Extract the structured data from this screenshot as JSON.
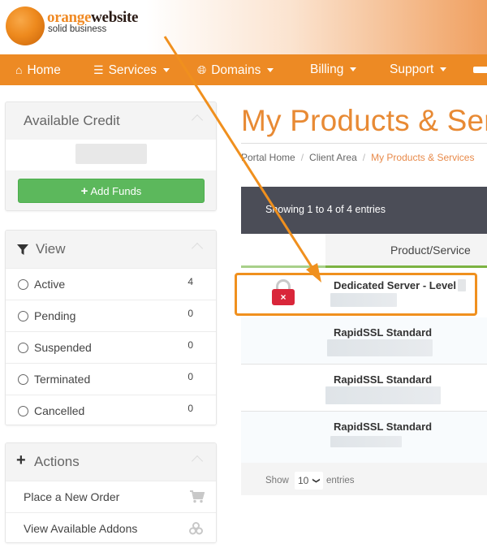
{
  "brand": {
    "name_part1": "orange",
    "name_part2": "website",
    "tagline": "solid business",
    "accent_color": "#ed8a24"
  },
  "nav": {
    "items": [
      {
        "label": "Home",
        "icon": "home-icon"
      },
      {
        "label": "Services",
        "icon": "bars-icon",
        "dropdown": true
      },
      {
        "label": "Domains",
        "icon": "globe-icon",
        "dropdown": true
      },
      {
        "label": "Billing",
        "dropdown": true
      },
      {
        "label": "Support",
        "dropdown": true
      }
    ]
  },
  "sidebar": {
    "credit": {
      "title": "Available Credit",
      "add_funds_label": "Add Funds"
    },
    "view": {
      "title": "View",
      "items": [
        {
          "label": "Active",
          "count": "4"
        },
        {
          "label": "Pending",
          "count": "0"
        },
        {
          "label": "Suspended",
          "count": "0"
        },
        {
          "label": "Terminated",
          "count": "0"
        },
        {
          "label": "Cancelled",
          "count": "0"
        }
      ]
    },
    "actions": {
      "title": "Actions",
      "items": [
        {
          "label": "Place a New Order",
          "icon": "cart-icon"
        },
        {
          "label": "View Available Addons",
          "icon": "cubes-icon"
        }
      ]
    }
  },
  "main": {
    "title": "My Products & Services",
    "breadcrumb": [
      "Portal Home",
      "Client Area",
      "My Products & Services"
    ],
    "table": {
      "showing_text": "Showing 1 to 4 of 4 entries",
      "column_header": "Product/Service",
      "rows": [
        {
          "name": "Dedicated Server - Level",
          "status_icon": "locked-icon",
          "highlighted": true
        },
        {
          "name": "RapidSSL Standard"
        },
        {
          "name": "RapidSSL Standard"
        },
        {
          "name": "RapidSSL Standard"
        }
      ],
      "footer": {
        "show_label": "Show",
        "page_size": "10",
        "entries_label": "entries"
      }
    }
  }
}
